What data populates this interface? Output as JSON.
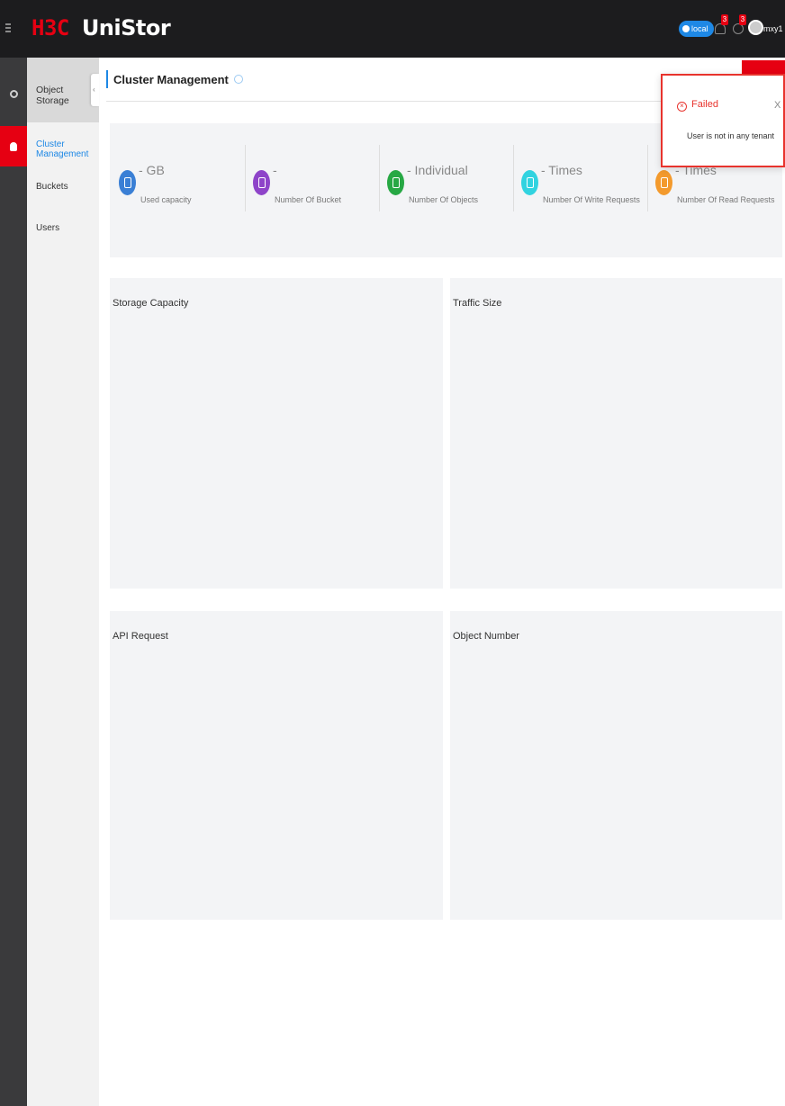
{
  "header": {
    "brand": "H3C",
    "product": "UniStor",
    "tenant": "local",
    "notification_badge": "3",
    "task_badge": "3",
    "username": "mxy1"
  },
  "sidebar": {
    "section_title": "Object Storage",
    "items": [
      {
        "label": "Cluster Management",
        "active": true
      },
      {
        "label": "Buckets",
        "active": false
      },
      {
        "label": "Users",
        "active": false
      }
    ]
  },
  "main": {
    "title": "Cluster Management",
    "stats": [
      {
        "value": "- GB",
        "label": "Used capacity",
        "icon": "database-icon",
        "color": "#3a7fd5"
      },
      {
        "value": "-",
        "label": "Number Of Bucket",
        "icon": "bucket-icon",
        "color": "#8e44c9"
      },
      {
        "value": "- Individual",
        "label": "Number Of Objects",
        "icon": "document-icon",
        "color": "#27a844"
      },
      {
        "value": "- Times",
        "label": "Number Of Write Requests",
        "icon": "upload-icon",
        "color": "#31d3e0"
      },
      {
        "value": "- Times",
        "label": "Number Of Read Requests",
        "icon": "download-icon",
        "color": "#f39a2d"
      }
    ],
    "panels": [
      {
        "title": "Storage Capacity"
      },
      {
        "title": "Traffic Size"
      },
      {
        "title": "API Request"
      },
      {
        "title": "Object Number"
      }
    ]
  },
  "notification": {
    "title": "Failed",
    "message": "User is not in any tenant",
    "close": "X"
  }
}
